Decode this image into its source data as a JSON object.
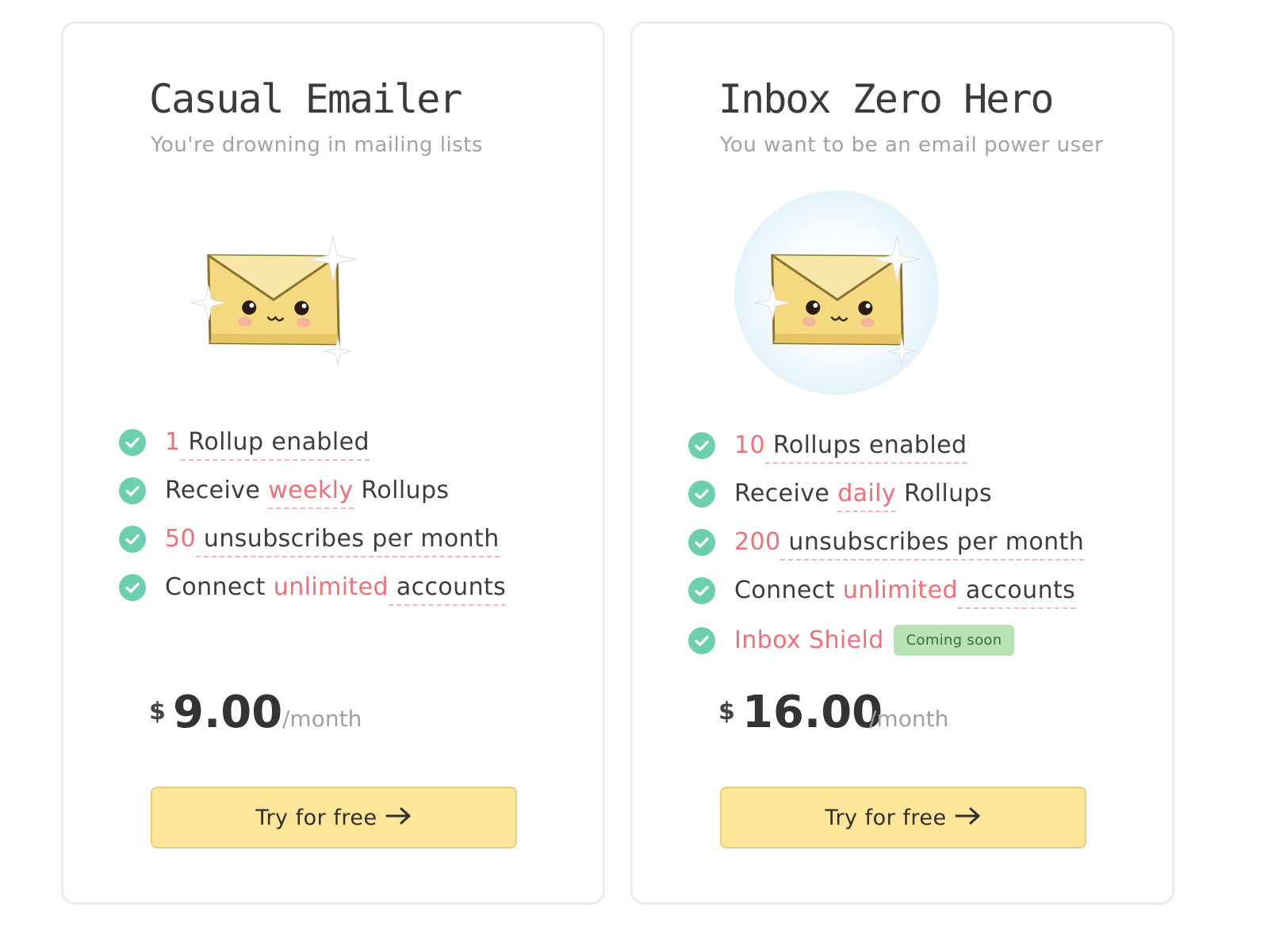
{
  "plans": [
    {
      "title": "Casual Emailer",
      "subtitle": "You're drowning in mailing lists",
      "features": [
        {
          "hl": "1",
          "text": " Rollup enabled"
        },
        {
          "pre": "Receive ",
          "hl": "weekly",
          "text": " Rollups"
        },
        {
          "hl": "50",
          "text": " unsubscribes per month"
        },
        {
          "pre": "Connect ",
          "hl": "unlimited",
          "text": " accounts"
        }
      ],
      "currency": "$",
      "price": "9.00",
      "period": "/month",
      "cta": "Try for free"
    },
    {
      "title": "Inbox Zero Hero",
      "subtitle": "You want to be an email power user",
      "features": [
        {
          "hl": "10",
          "text": " Rollups enabled"
        },
        {
          "pre": "Receive ",
          "hl": "daily",
          "text": " Rollups"
        },
        {
          "hl": "200",
          "text": " unsubscribes per month"
        },
        {
          "pre": "Connect ",
          "hl": "unlimited",
          "text": " accounts"
        },
        {
          "hl": "Inbox Shield",
          "badge": "Coming soon"
        }
      ],
      "currency": "$",
      "price": "16.00",
      "period": "/month",
      "cta": "Try for free"
    }
  ],
  "icons": {
    "check": "check-circle-icon",
    "arrow": "arrow-right-icon",
    "mascot": "envelope-mascot-icon"
  },
  "colors": {
    "accent": "#f0707a",
    "check": "#6ccfb0",
    "button": "#fde59a",
    "badge": "#b7e3b5"
  }
}
